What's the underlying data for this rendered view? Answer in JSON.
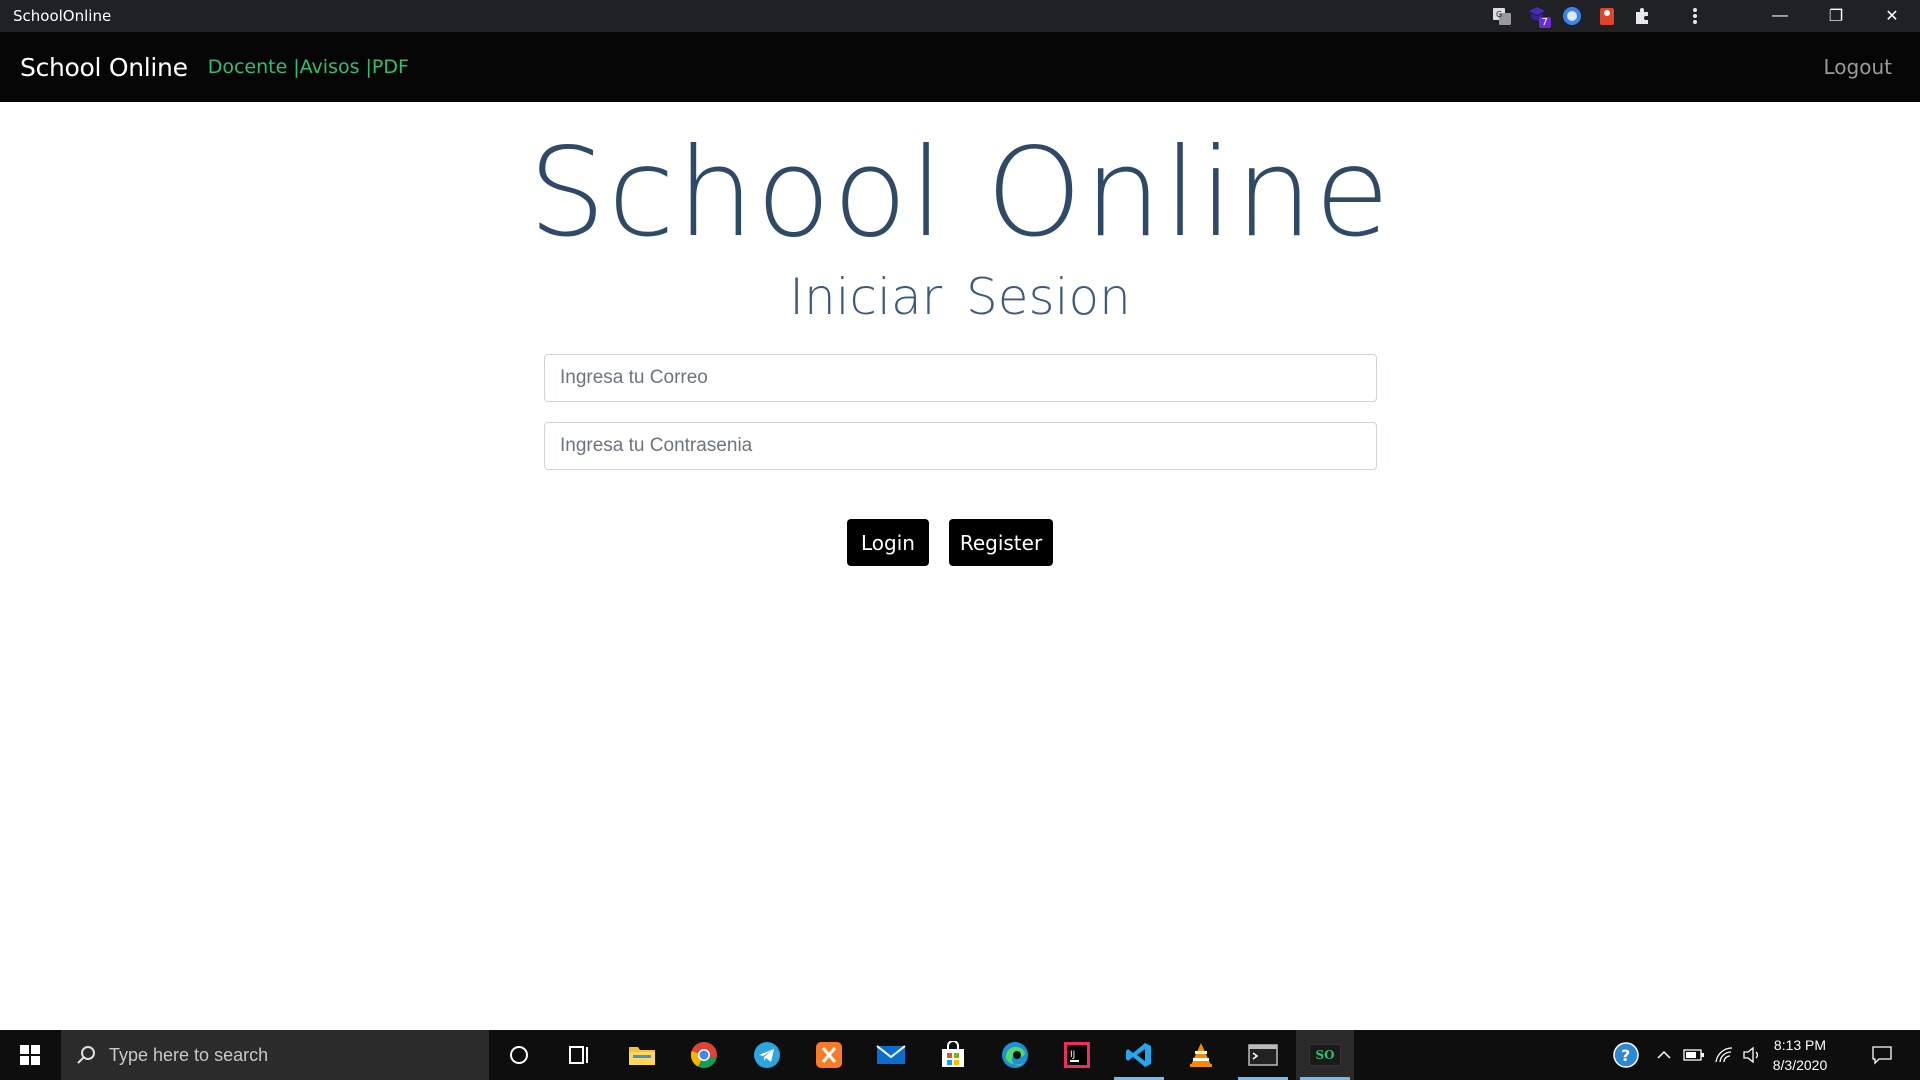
{
  "window": {
    "title": "SchoolOnline",
    "extension_badge": "7",
    "controls": {
      "minimize": "—",
      "maximize": "❐",
      "close": "✕"
    }
  },
  "navbar": {
    "brand": "School Online",
    "links": [
      "Docente",
      "|Avisos",
      "|PDF"
    ],
    "logout": "Logout"
  },
  "main": {
    "title": "School Online",
    "subtitle": "Iniciar Sesion",
    "email_placeholder": "Ingresa tu Correo",
    "password_placeholder": "Ingresa tu Contrasenia",
    "login_label": "Login",
    "register_label": "Register"
  },
  "taskbar": {
    "search_placeholder": "Type here to search",
    "apps": [
      "cortana-icon",
      "task-view-icon",
      "file-explorer-icon",
      "chrome-icon",
      "telegram-icon",
      "xampp-icon",
      "mail-icon",
      "store-icon",
      "edge-icon",
      "intellij-icon",
      "vscode-icon",
      "vlc-icon",
      "terminal-icon",
      "schoolonline-app-icon"
    ],
    "current_app_label": "SO",
    "time": "8:13 PM",
    "date": "8/3/2020"
  },
  "colors": {
    "navbar_bg": "#050505",
    "nav_link": "#2fbf72",
    "title_text": "#2f4a66",
    "button_bg": "#000000"
  }
}
